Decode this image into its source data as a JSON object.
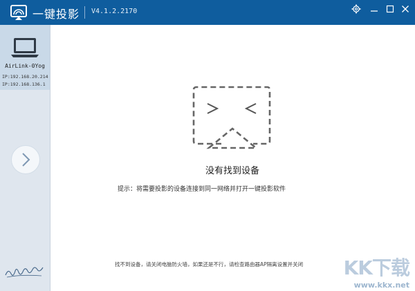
{
  "titlebar": {
    "app_title": "一键投影",
    "version": "V4.1.2.2170",
    "icons": {
      "logo": "cast-logo-icon",
      "settings": "gear-icon",
      "minimize": "minimize-icon",
      "maximize": "maximize-icon",
      "close": "close-icon"
    }
  },
  "sidebar": {
    "device": {
      "icon": "laptop-icon",
      "name": "AirLink-0Yog",
      "ip1": "IP:192.168.20.214",
      "ip2": "IP:192.168.136.1"
    },
    "next_icon": "chevron-right-icon",
    "signature": "比佬都更开作"
  },
  "main": {
    "empty_title": "没有找到设备",
    "empty_tip": "提示：将需要投影的设备连接到同一网络并打开一键投影软件",
    "footer_hint": "找不到设备，请关闭电脑防火墙，如果还是不行，请检查路由器AP隔离设置并关闭"
  },
  "watermark": {
    "brand": "KK下载",
    "url": "www.kkx.net"
  },
  "colors": {
    "titlebar": "#0f5d9e",
    "sidebar": "#dfe6ee",
    "device_card": "#c9d9e8",
    "dashes": "#666666"
  }
}
